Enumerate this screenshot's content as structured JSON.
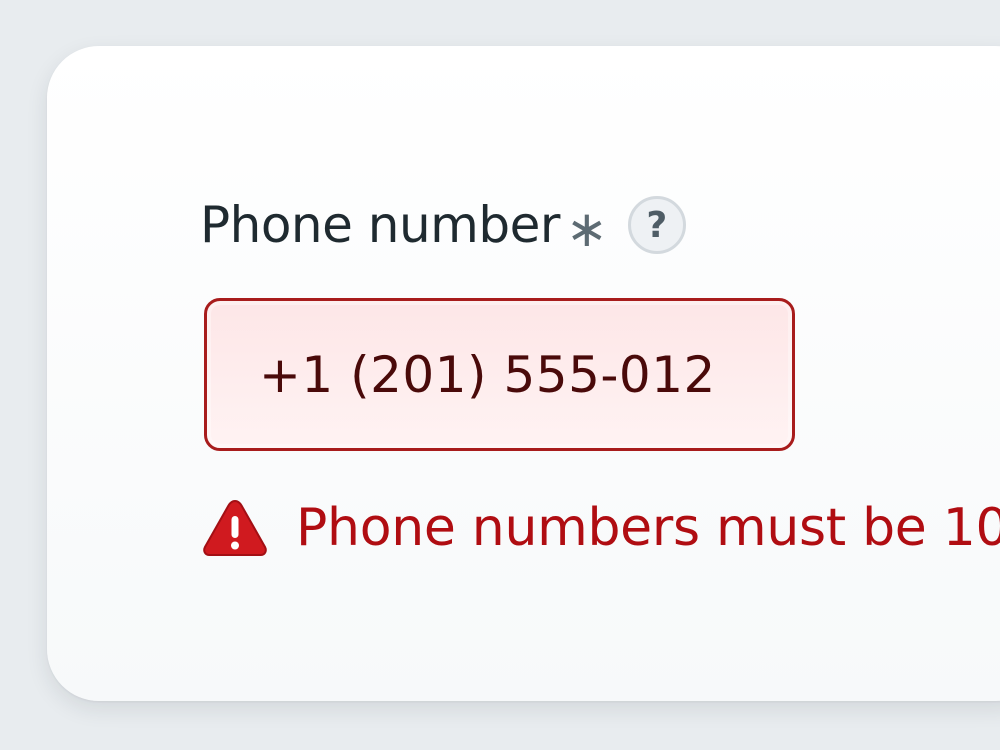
{
  "form": {
    "label": "Phone number",
    "required_mark": "∗",
    "help_icon_label": "?",
    "input_value": "+1 (201) 555-012",
    "error_message": "Phone numbers must be 10"
  },
  "colors": {
    "error": "#b00d12",
    "input_border": "#a81c1c",
    "input_background": "#fde6e7",
    "label": "#1f2a30"
  },
  "icons": {
    "help": "question-mark-circle",
    "error": "warning-triangle"
  }
}
